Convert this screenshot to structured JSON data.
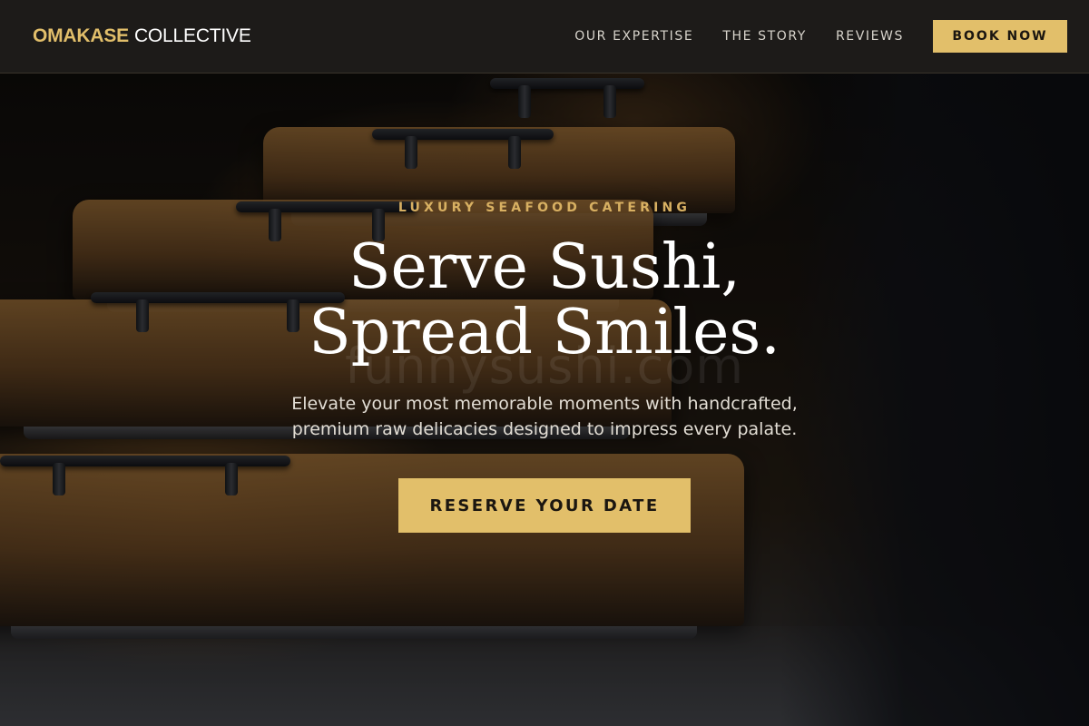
{
  "nav": {
    "brand_primary": "OMAKASE",
    "brand_secondary": "COLLECTIVE",
    "links": [
      {
        "label": "OUR EXPERTISE"
      },
      {
        "label": "THE STORY"
      },
      {
        "label": "REVIEWS"
      }
    ],
    "book_label": "BOOK NOW"
  },
  "hero": {
    "eyebrow": "LUXURY SEAFOOD CATERING",
    "headline_line1": "Serve Sushi,",
    "headline_line2": "Spread Smiles.",
    "subtext_line1": "Elevate your most memorable moments with handcrafted,",
    "subtext_line2": "premium raw delicacies designed to impress every palate.",
    "cta_label": "RESERVE YOUR DATE",
    "watermark": "funnysushi.com"
  },
  "colors": {
    "accent_gold": "#e2bf6a",
    "nav_background": "#1d1b19",
    "eyebrow_gold": "#d8b062"
  }
}
